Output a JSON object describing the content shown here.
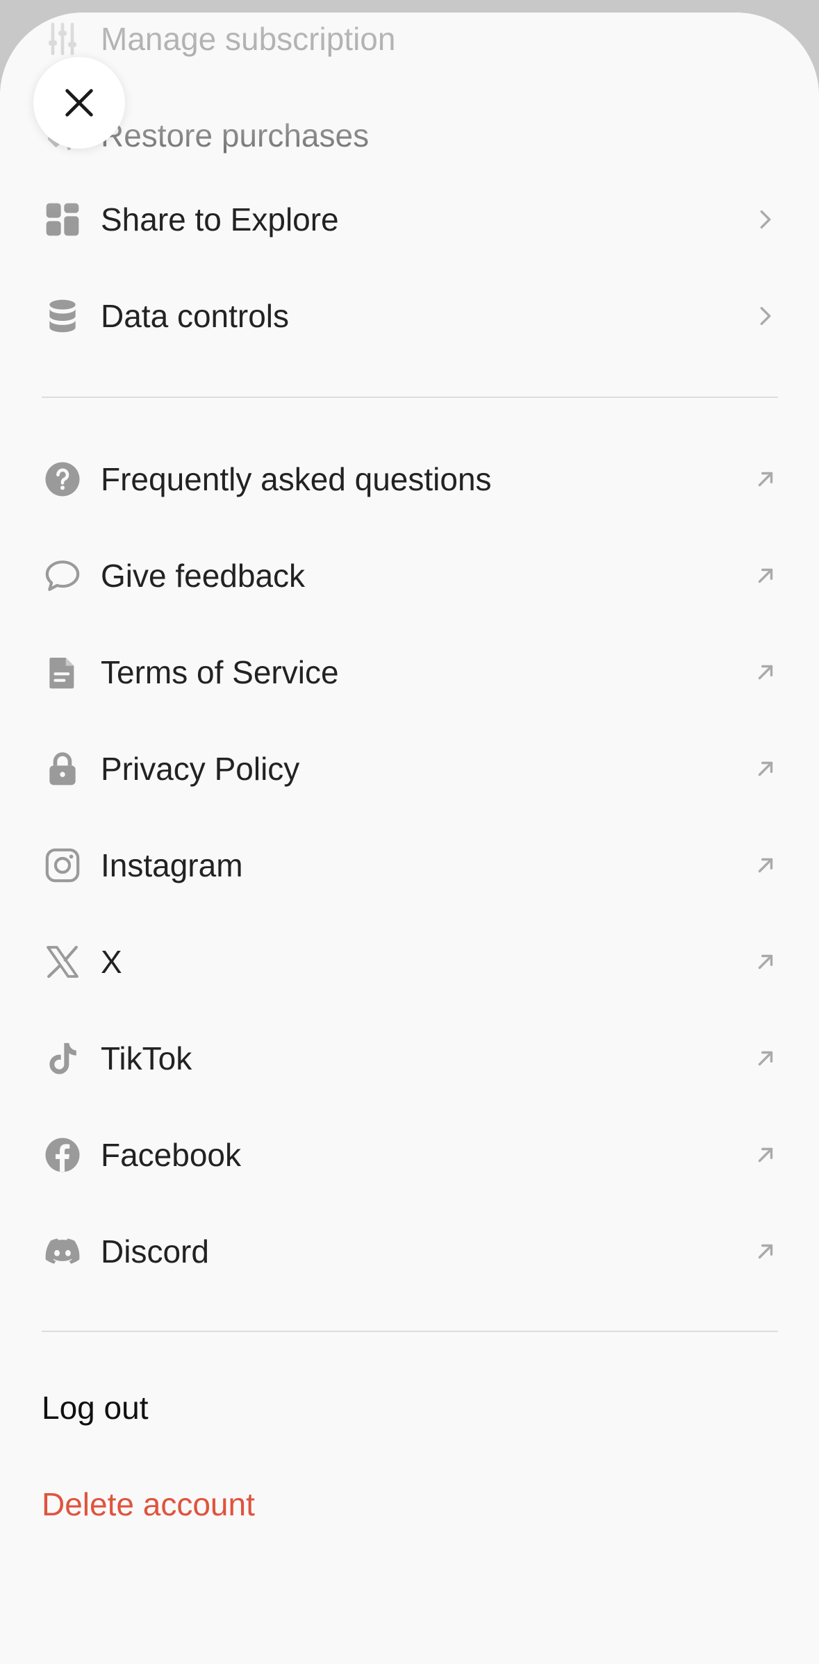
{
  "menu": {
    "top_items": [
      {
        "label": "Manage subscription",
        "icon": "sliders-icon"
      },
      {
        "label": "Restore purchases",
        "icon": "restore-icon"
      },
      {
        "label": "Share to Explore",
        "icon": "grid-icon"
      },
      {
        "label": "Data controls",
        "icon": "database-icon"
      }
    ],
    "link_items": [
      {
        "label": "Frequently asked questions",
        "icon": "question-icon"
      },
      {
        "label": "Give feedback",
        "icon": "chat-bubble-icon"
      },
      {
        "label": "Terms of Service",
        "icon": "document-icon"
      },
      {
        "label": "Privacy Policy",
        "icon": "lock-icon"
      },
      {
        "label": "Instagram",
        "icon": "instagram-icon"
      },
      {
        "label": "X",
        "icon": "x-logo-icon"
      },
      {
        "label": "TikTok",
        "icon": "tiktok-icon"
      },
      {
        "label": "Facebook",
        "icon": "facebook-icon"
      },
      {
        "label": "Discord",
        "icon": "discord-icon"
      }
    ]
  },
  "account": {
    "logout_label": "Log out",
    "delete_label": "Delete account"
  },
  "colors": {
    "danger": "#e0533d",
    "icon_gray": "#9a9a9a",
    "text": "#222222"
  }
}
